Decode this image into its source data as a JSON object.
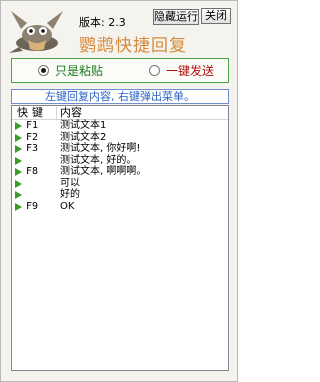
{
  "header": {
    "version_label": "版本: 2.3",
    "app_title": "鹦鹉快捷回复",
    "hide_button": "隐藏运行",
    "close_button": "关闭"
  },
  "mode": {
    "options": [
      {
        "label": "只是粘贴",
        "selected": true
      },
      {
        "label": "一键发送",
        "selected": false
      }
    ]
  },
  "hint_text": "左键回复内容, 右键弹出菜单。",
  "list": {
    "columns": [
      "快键",
      "内容"
    ],
    "rows": [
      {
        "key": "F1",
        "text": "测试文本1"
      },
      {
        "key": "F2",
        "text": "测试文本2"
      },
      {
        "key": "F3",
        "text": "测试文本, 你好啊!"
      },
      {
        "key": "",
        "text": "测试文本, 好的。"
      },
      {
        "key": "F8",
        "text": "测试文本, 啊啊啊。"
      },
      {
        "key": "",
        "text": "可以"
      },
      {
        "key": "",
        "text": "好的"
      },
      {
        "key": "F9",
        "text": "OK"
      }
    ]
  },
  "colors": {
    "title": "#d6893a",
    "mode_border": "#4aa54a",
    "hint_text": "#2b62c4",
    "row_marker": "#3a9a2a"
  },
  "icons": {
    "logo": "gimp-mascot-logo-icon",
    "row_marker": "play-triangle-icon"
  }
}
